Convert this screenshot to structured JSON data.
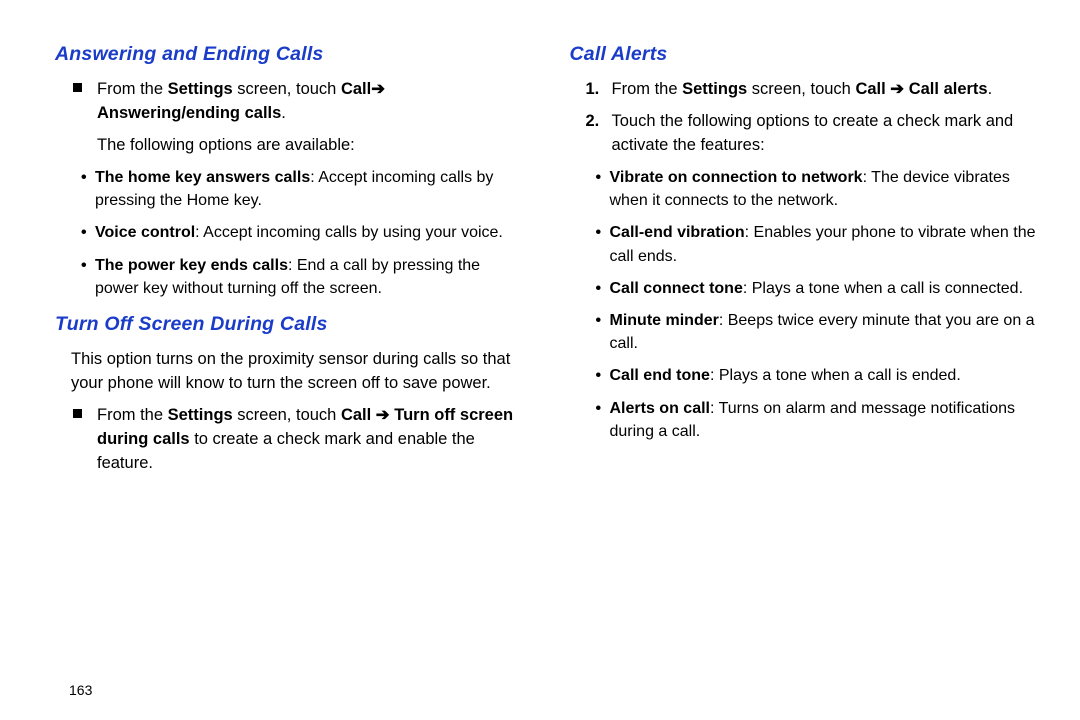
{
  "arrow": "➔",
  "pageNumber": "163",
  "left": {
    "h1": "Answering and Ending Calls",
    "sq1_pre": "From the ",
    "sq1_settings": "Settings",
    "sq1_mid": " screen, touch ",
    "sq1_call": "Call",
    "sq1_answer": "Answering/ending calls",
    "sq1_period": ".",
    "avail": "The following options are available:",
    "b1_bold": "The home key answers calls",
    "b1_rest": ": Accept incoming calls by pressing the Home key.",
    "b2_bold": "Voice control",
    "b2_rest": ": Accept incoming calls by using your voice.",
    "b3_bold": "The power key ends calls",
    "b3_rest": ": End a call by pressing the power key without turning off the screen.",
    "h2": "Turn Off Screen During Calls",
    "h2_para": "This option turns on the proximity sensor during calls so that your phone will know to turn the screen off to save power.",
    "sq2_pre": "From the ",
    "sq2_settings": "Settings",
    "sq2_mid": " screen, touch ",
    "sq2_call": "Call",
    "sq2_sp": " ",
    "sq2_turnoff": "Turn off screen during calls",
    "sq2_rest": " to create a check mark and enable the feature."
  },
  "right": {
    "h1": "Call Alerts",
    "n1_num": "1.",
    "n1_pre": "From the ",
    "n1_settings": "Settings",
    "n1_mid": " screen, touch ",
    "n1_call": "Call",
    "n1_sp": " ",
    "n1_alerts": "Call alerts",
    "n1_period": ".",
    "n2_num": "2.",
    "n2_text": "Touch the following options to create a check mark and activate the features:",
    "b1_bold": "Vibrate on connection to network",
    "b1_rest": ": The device vibrates when it connects to the network.",
    "b2_bold": "Call-end vibration",
    "b2_rest": ": Enables your phone to vibrate when the call ends.",
    "b3_bold": "Call connect tone",
    "b3_rest": ": Plays a tone when a call is connected.",
    "b4_bold": "Minute minder",
    "b4_rest": ": Beeps twice every minute that you are on a call.",
    "b5_bold": "Call end tone",
    "b5_rest": ": Plays a tone when a call is ended.",
    "b6_bold": "Alerts on call",
    "b6_rest": ": Turns on alarm and message notifications during a call."
  }
}
